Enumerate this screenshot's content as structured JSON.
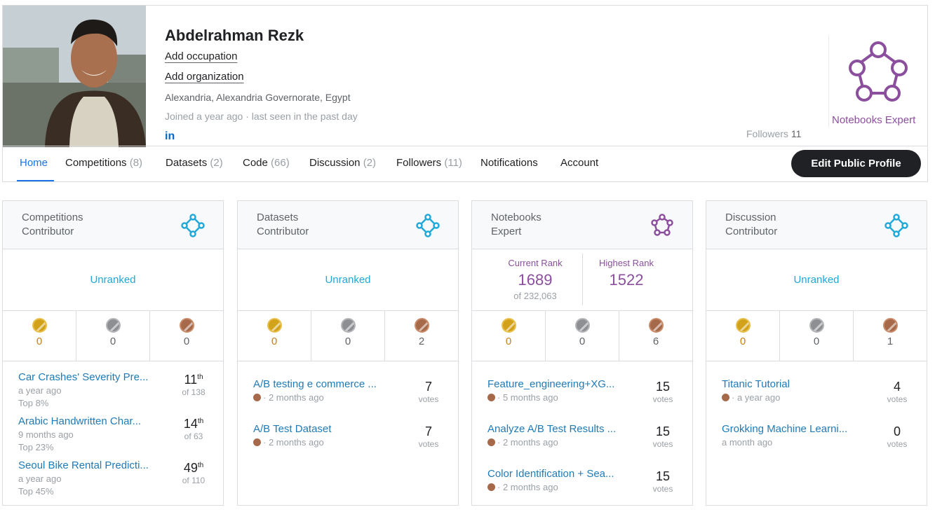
{
  "profile": {
    "name": "Abdelrahman Rezk",
    "occupation_link": "Add occupation",
    "organization_link": "Add organization",
    "location": "Alexandria, Alexandria Governorate, Egypt",
    "joined": "Joined a year ago · last seen in the past day",
    "linkedin_icon": "in",
    "tier_label": "Notebooks Expert",
    "followers_label": "Followers",
    "followers_count": "11",
    "accent_color": "#8b4f9d"
  },
  "tabs": [
    {
      "label": "Home",
      "count": ""
    },
    {
      "label": "Competitions",
      "count": "(8)"
    },
    {
      "label": "Datasets",
      "count": "(2)"
    },
    {
      "label": "Code",
      "count": "(66)"
    },
    {
      "label": "Discussion",
      "count": "(2)"
    },
    {
      "label": "Followers",
      "count": "(11)"
    },
    {
      "label": "Notifications",
      "count": ""
    },
    {
      "label": "Account",
      "count": ""
    }
  ],
  "edit_button": "Edit Public Profile",
  "cards": [
    {
      "title1": "Competitions",
      "title2": "Contributor",
      "rank": "Unranked",
      "medals": {
        "gold": "0",
        "silver": "0",
        "bronze": "0"
      },
      "items": [
        {
          "title": "Car Crashes' Severity Pre...",
          "meta": "a year ago",
          "meta2": "Top 8%",
          "value": "11",
          "suffix": "th",
          "sub": "of 138"
        },
        {
          "title": "Arabic Handwritten Char...",
          "meta": "9 months ago",
          "meta2": "Top 23%",
          "value": "14",
          "suffix": "th",
          "sub": "of 63"
        },
        {
          "title": "Seoul Bike Rental Predicti...",
          "meta": "a year ago",
          "meta2": "Top 45%",
          "value": "49",
          "suffix": "th",
          "sub": "of 110"
        }
      ]
    },
    {
      "title1": "Datasets",
      "title2": "Contributor",
      "rank": "Unranked",
      "medals": {
        "gold": "0",
        "silver": "0",
        "bronze": "2"
      },
      "items": [
        {
          "title": "A/B testing e commerce ...",
          "meta": "· 2 months ago",
          "value": "7",
          "sub": "votes"
        },
        {
          "title": "A/B Test Dataset",
          "meta": "· 2 months ago",
          "value": "7",
          "sub": "votes"
        }
      ]
    },
    {
      "title1": "Notebooks",
      "title2": "Expert",
      "current_rank_label": "Current Rank",
      "current_rank": "1689",
      "current_of": "of 232,063",
      "highest_rank_label": "Highest Rank",
      "highest_rank": "1522",
      "medals": {
        "gold": "0",
        "silver": "0",
        "bronze": "6"
      },
      "items": [
        {
          "title": "Feature_engineering+XG...",
          "meta": "· 5 months ago",
          "value": "15",
          "sub": "votes"
        },
        {
          "title": "Analyze A/B Test Results ...",
          "meta": "· 2 months ago",
          "value": "15",
          "sub": "votes"
        },
        {
          "title": "Color Identification + Sea...",
          "meta": "· 2 months ago",
          "value": "15",
          "sub": "votes"
        }
      ]
    },
    {
      "title1": "Discussion",
      "title2": "Contributor",
      "rank": "Unranked",
      "medals": {
        "gold": "0",
        "silver": "0",
        "bronze": "1"
      },
      "items": [
        {
          "title": "Titanic Tutorial",
          "meta": "· a year ago",
          "value": "4",
          "sub": "votes"
        },
        {
          "title": "Grokking Machine Learni...",
          "meta": "a month ago",
          "value": "0",
          "sub": "votes"
        }
      ]
    }
  ]
}
